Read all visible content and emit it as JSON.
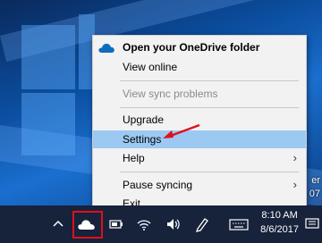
{
  "menu": {
    "items": [
      {
        "label": "Open your OneDrive folder",
        "style": "bold",
        "icon": "onedrive-cloud-icon"
      },
      {
        "label": "View online"
      },
      {
        "label": "View sync problems",
        "style": "disabled"
      },
      {
        "label": "Upgrade"
      },
      {
        "label": "Settings",
        "style": "highlight"
      },
      {
        "label": "Help",
        "submenu": true
      },
      {
        "label": "Pause syncing",
        "submenu": true
      },
      {
        "label": "Exit"
      }
    ]
  },
  "taskbar": {
    "clock": {
      "time": "8:10 AM",
      "date": "8/6/2017"
    },
    "tray_icons": [
      "chevron-up-icon",
      "onedrive-cloud-icon",
      "battery-icon",
      "wifi-icon",
      "volume-icon",
      "pen-icon",
      "keyboard-icon",
      "notification-icon"
    ]
  },
  "desktop": {
    "partial_texts": [
      "er",
      "07"
    ]
  },
  "colors": {
    "menu_background": "#f2f2f2",
    "highlight": "#9cc9f2",
    "onedrive_blue": "#0f6cbd",
    "annotation_red": "#e0101a",
    "taskbar": "#17223b"
  }
}
